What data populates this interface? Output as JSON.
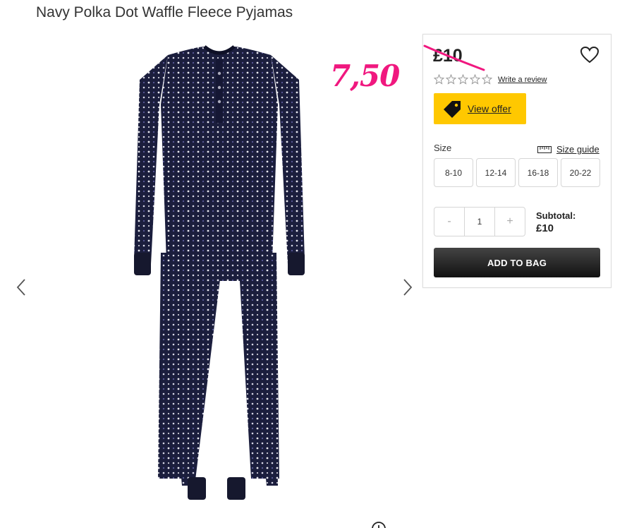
{
  "product": {
    "title": "Navy Polka Dot Waffle Fleece Pyjamas",
    "image_alt": "Navy polka dot pyjamas",
    "old_price": "£10",
    "promo_price": "7,50",
    "rating": {
      "stars": 0,
      "max": 5
    },
    "review_link": "Write a review",
    "offer_label": "View offer",
    "size_label": "Size",
    "size_guide_label": "Size guide",
    "sizes": [
      "8-10",
      "12-14",
      "16-18",
      "20-22"
    ],
    "quantity": {
      "minus": "-",
      "value": "1",
      "plus": "+"
    },
    "subtotal": {
      "label": "Subtotal:",
      "value": "£10"
    },
    "add_to_bag_label": "ADD TO BAG"
  },
  "icons": {
    "prev": "chevron-left-icon",
    "next": "chevron-right-icon",
    "wishlist": "heart-icon",
    "offer": "tag-icon",
    "size_guide": "ruler-icon",
    "zoom": "zoom-icon",
    "star": "star-outline-icon"
  },
  "colors": {
    "promo_price": "#f0187f",
    "strike": "#f0187f",
    "offer_button": "#ffc800",
    "add_button": "#1a1a1a",
    "garment": "#1b1e3d"
  }
}
